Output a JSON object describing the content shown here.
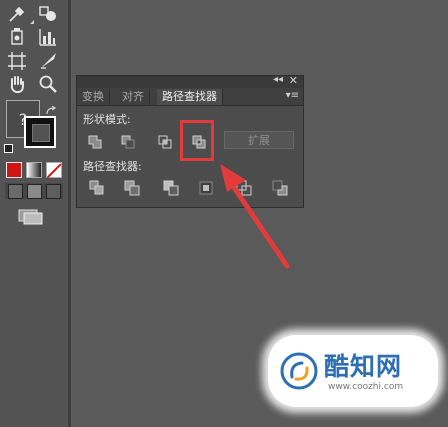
{
  "toolbar": {
    "tools": [
      {
        "name": "eyedropper-tool-icon"
      },
      {
        "name": "blend-tool-icon"
      },
      {
        "name": "symbol-sprayer-tool-icon"
      },
      {
        "name": "column-graph-tool-icon"
      },
      {
        "name": "artboard-tool-icon"
      },
      {
        "name": "slice-tool-icon"
      },
      {
        "name": "hand-tool-icon"
      },
      {
        "name": "zoom-tool-icon"
      }
    ],
    "fill_help_glyph": "?"
  },
  "panel": {
    "tabs": [
      {
        "label": "变换",
        "active": false
      },
      {
        "label": "对齐",
        "active": false
      },
      {
        "label": "路径查找器",
        "active": true
      }
    ],
    "shape_modes_label": "形状模式:",
    "pathfinders_label": "路径查找器:",
    "expand_label": "扩展",
    "shape_mode_buttons": [
      "unite-icon",
      "minus-front-icon",
      "intersect-icon",
      "exclude-icon"
    ],
    "pathfinder_buttons": [
      "divide-icon",
      "trim-icon",
      "merge-icon",
      "crop-icon",
      "outline-icon",
      "minus-back-icon"
    ]
  },
  "watermark": {
    "name": "酷知网",
    "url": "www.coozhi.com"
  },
  "colors": {
    "highlight": "#e23b3b",
    "fill_red": "#cc0000",
    "watermark_blue": "#2d6fb2"
  }
}
